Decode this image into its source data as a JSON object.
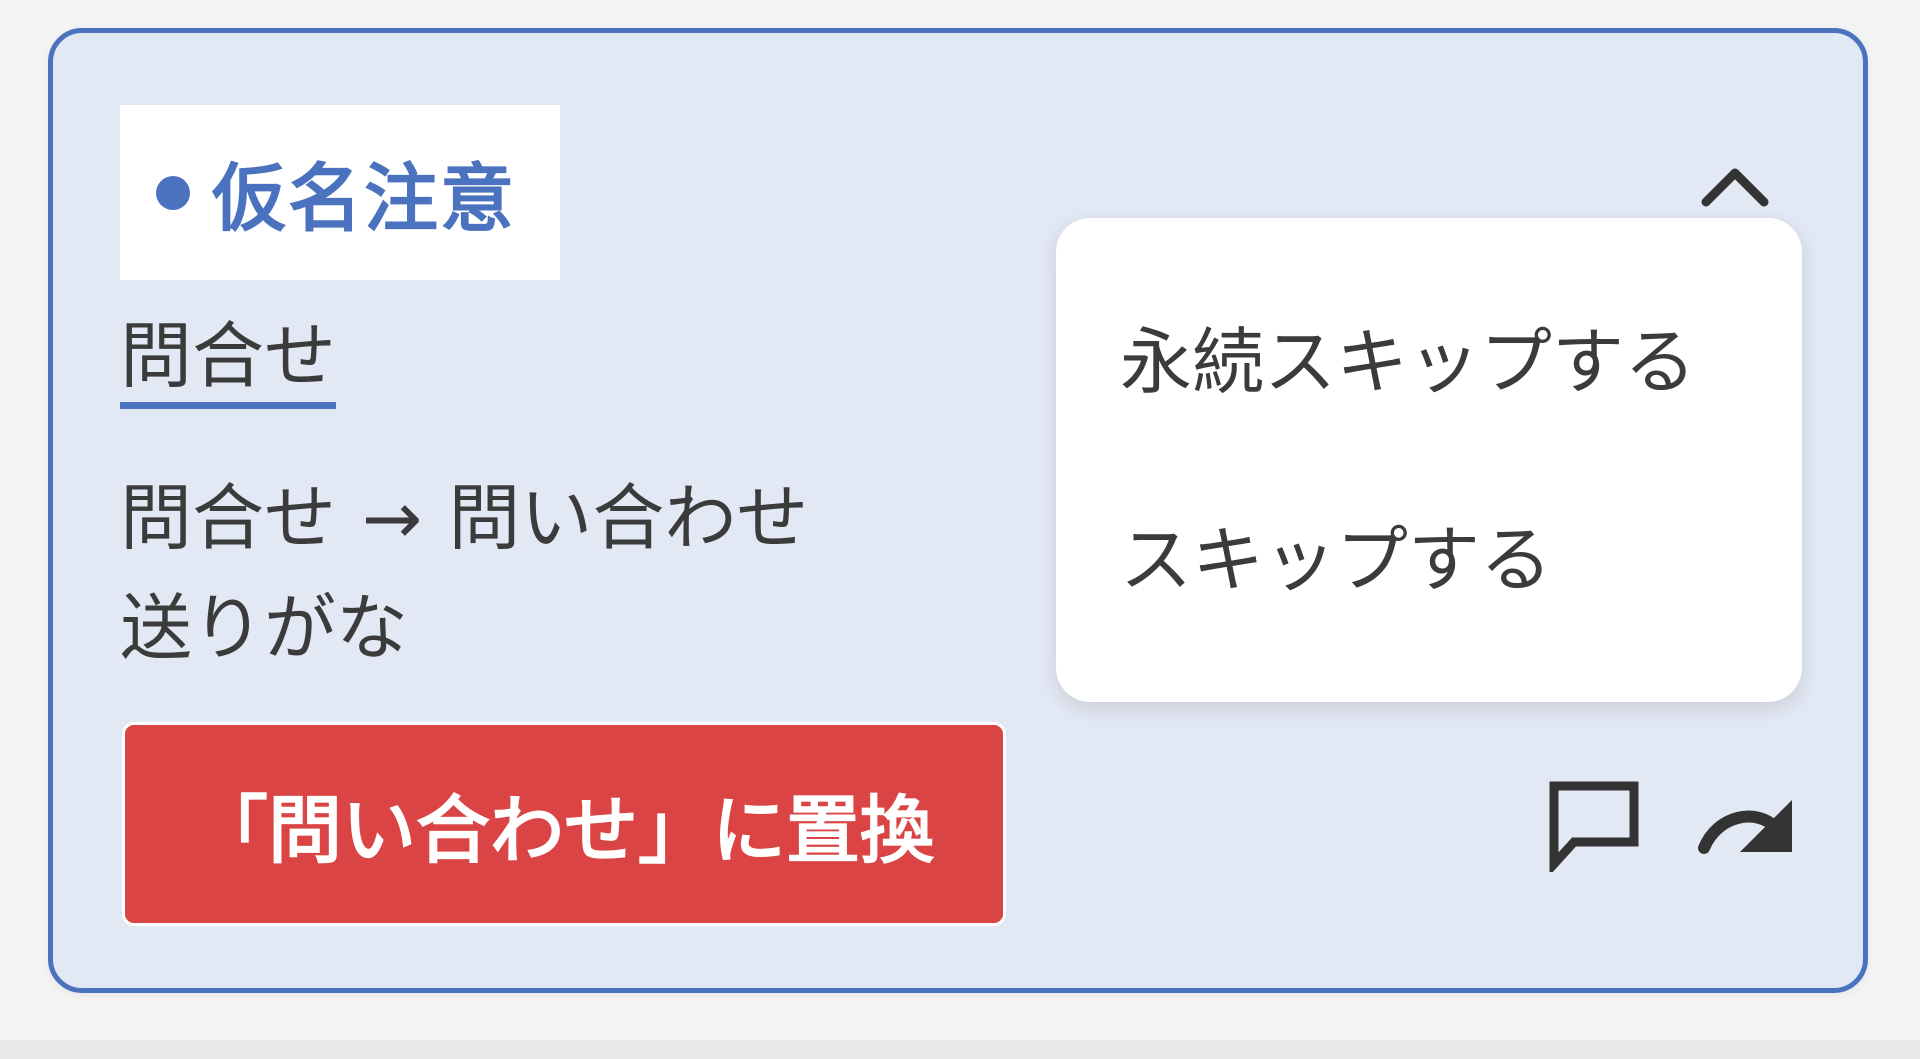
{
  "card": {
    "category_tag": "仮名注意",
    "flagged_term": "問合せ",
    "suggestion": {
      "original": "問合せ",
      "arrow": "→",
      "replacement": "問い合わせ"
    },
    "rule_type": "送りがな",
    "replace_button_label": "「問い合わせ」に置換"
  },
  "dropdown_menu": {
    "items": [
      {
        "label": "永続スキップする"
      },
      {
        "label": "スキップする"
      }
    ]
  },
  "icons": {
    "collapse": "chevron-up-icon",
    "comment": "comment-icon",
    "redo": "redo-icon"
  },
  "colors": {
    "accent": "#4a72bf",
    "card_background": "#e3e9f4",
    "danger": "#da4444",
    "text": "#3b3b3b"
  }
}
